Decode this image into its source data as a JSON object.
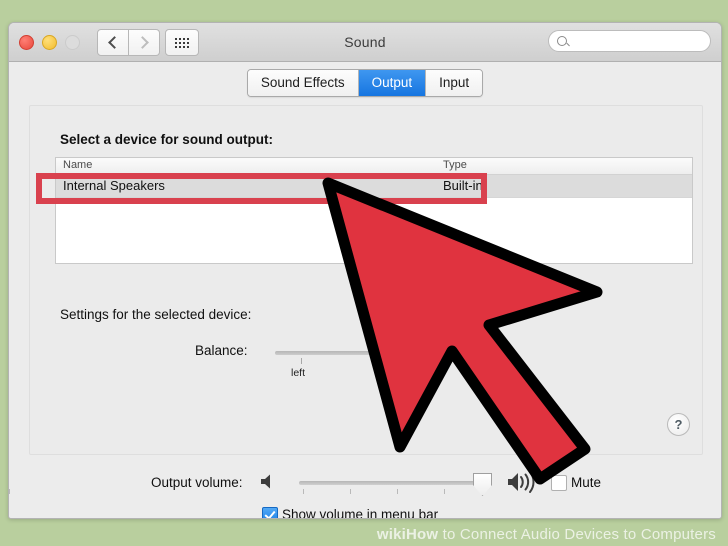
{
  "window": {
    "title": "Sound",
    "traffic_lights": [
      "close",
      "minimize",
      "zoom"
    ],
    "nav_back_icon": "chevron-left-icon",
    "nav_forward_icon": "chevron-right-icon",
    "grid_icon": "show-all-grid-icon",
    "search": {
      "value": "",
      "placeholder": "",
      "icon": "search-icon"
    }
  },
  "tabs": [
    {
      "label": "Sound Effects",
      "selected": false
    },
    {
      "label": "Output",
      "selected": true
    },
    {
      "label": "Input",
      "selected": false
    }
  ],
  "main": {
    "section_title": "Select a device for sound output:",
    "table": {
      "columns": [
        "Name",
        "Type"
      ],
      "rows": [
        {
          "name": "Internal Speakers",
          "type": "Built-in",
          "selected": true
        }
      ]
    },
    "settings_label": "Settings for the selected device:",
    "balance": {
      "label": "Balance:",
      "tick_label": "left",
      "value": 0
    },
    "help_label": "?"
  },
  "bottom": {
    "output_volume_label": "Output volume:",
    "volume_low_icon": "speaker-low-icon",
    "volume_high_icon": "speaker-high-icon",
    "volume_value": 91,
    "mute": {
      "label": "Mute",
      "checked": false
    },
    "show_volume": {
      "label": "Show volume in menu bar",
      "checked": true
    }
  },
  "annotation": {
    "highlight_color": "#d9414e",
    "cursor_color": "#e0333f",
    "cursor_outline": "#000000"
  },
  "watermark": {
    "brand": "wiki",
    "brand_suffix": "How",
    "text": " to Connect Audio Devices to Computers"
  }
}
